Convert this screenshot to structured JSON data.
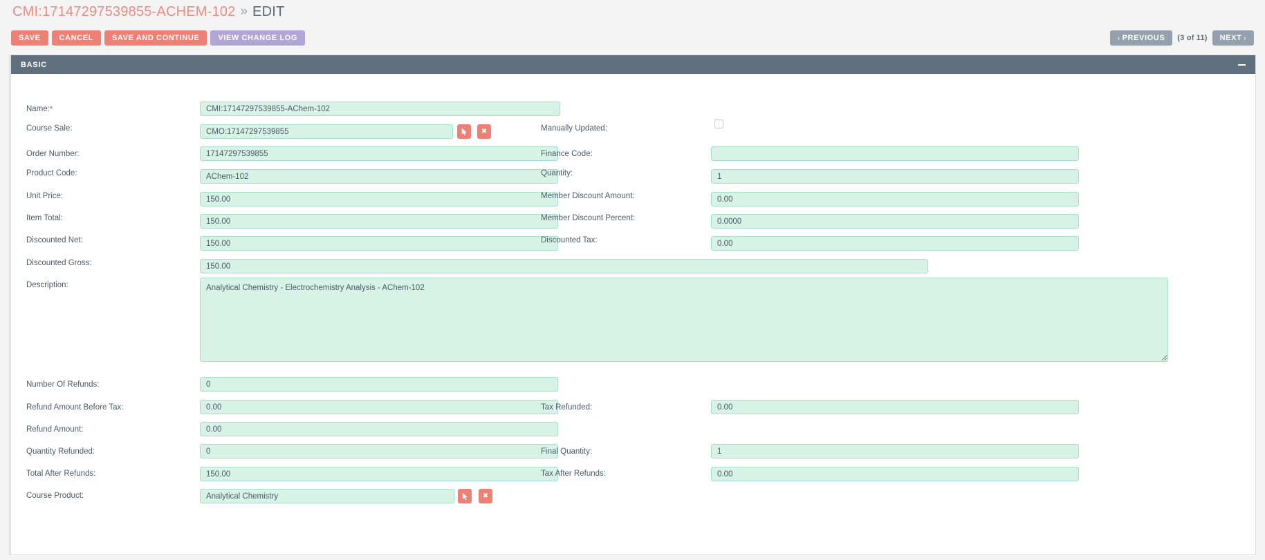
{
  "header": {
    "record_title": "CMI:17147297539855-ACHEM-102",
    "separator": "»",
    "mode": "EDIT"
  },
  "toolbar": {
    "save_label": "SAVE",
    "cancel_label": "CANCEL",
    "save_continue_label": "SAVE AND CONTINUE",
    "change_log_label": "VIEW CHANGE LOG"
  },
  "pager": {
    "previous_label": "PREVIOUS",
    "count_label": "(3 of 11)",
    "next_label": "NEXT",
    "prev_chevron": "‹",
    "next_chevron": "›"
  },
  "panel": {
    "title": "BASIC",
    "collapse_icon": "minus-icon"
  },
  "lookup": {
    "pick_icon": "cursor-arrow-icon",
    "clear_icon": "close-x-icon",
    "clear_glyph": "✖"
  },
  "fields": {
    "name": {
      "label": "Name:",
      "required": true,
      "value": "CMI:17147297539855-AChem-102"
    },
    "course_sale": {
      "label": "Course Sale:",
      "value": "CMO:17147297539855"
    },
    "manually_updated": {
      "label": "Manually Updated:",
      "checked": false
    },
    "order_number": {
      "label": "Order Number:",
      "value": "17147297539855"
    },
    "finance_code": {
      "label": "Finance Code:",
      "value": ""
    },
    "product_code": {
      "label": "Product Code:",
      "value": "AChem-102"
    },
    "quantity": {
      "label": "Quantity:",
      "value": "1"
    },
    "unit_price": {
      "label": "Unit Price:",
      "value": "150.00"
    },
    "member_discount_amount": {
      "label": "Member Discount Amount:",
      "value": "0.00"
    },
    "item_total": {
      "label": "Item Total:",
      "value": "150.00"
    },
    "member_discount_percent": {
      "label": "Member Discount Percent:",
      "value": "0.0000"
    },
    "discounted_net": {
      "label": "Discounted Net:",
      "value": "150.00"
    },
    "discounted_tax": {
      "label": "Discounted Tax:",
      "value": "0.00"
    },
    "discounted_gross": {
      "label": "Discounted Gross:",
      "value": "150.00"
    },
    "description": {
      "label": "Description:",
      "value": "Analytical Chemistry - Electrochemistry Analysis - AChem-102"
    },
    "number_of_refunds": {
      "label": "Number Of Refunds:",
      "value": "0"
    },
    "refund_amount_before_tax": {
      "label": "Refund Amount Before Tax:",
      "value": "0.00"
    },
    "tax_refunded": {
      "label": "Tax Refunded:",
      "value": "0.00"
    },
    "refund_amount": {
      "label": "Refund Amount:",
      "value": "0.00"
    },
    "quantity_refunded": {
      "label": "Quantity Refunded:",
      "value": "0"
    },
    "final_quantity": {
      "label": "Final Quantity:",
      "value": "1"
    },
    "total_after_refunds": {
      "label": "Total After Refunds:",
      "value": "150.00"
    },
    "tax_after_refunds": {
      "label": "Tax After Refunds:",
      "value": "0.00"
    },
    "course_product": {
      "label": "Course Product:",
      "value": "Analytical Chemistry"
    }
  },
  "colors": {
    "accent_salmon": "#ed8175",
    "accent_purple": "#b1a5d3",
    "panel_header": "#5f6f7e",
    "field_bg": "#d7f2e6",
    "field_border": "#a9dfca",
    "label_text": "#4e5b69",
    "page_bg": "#f4f4f4"
  }
}
